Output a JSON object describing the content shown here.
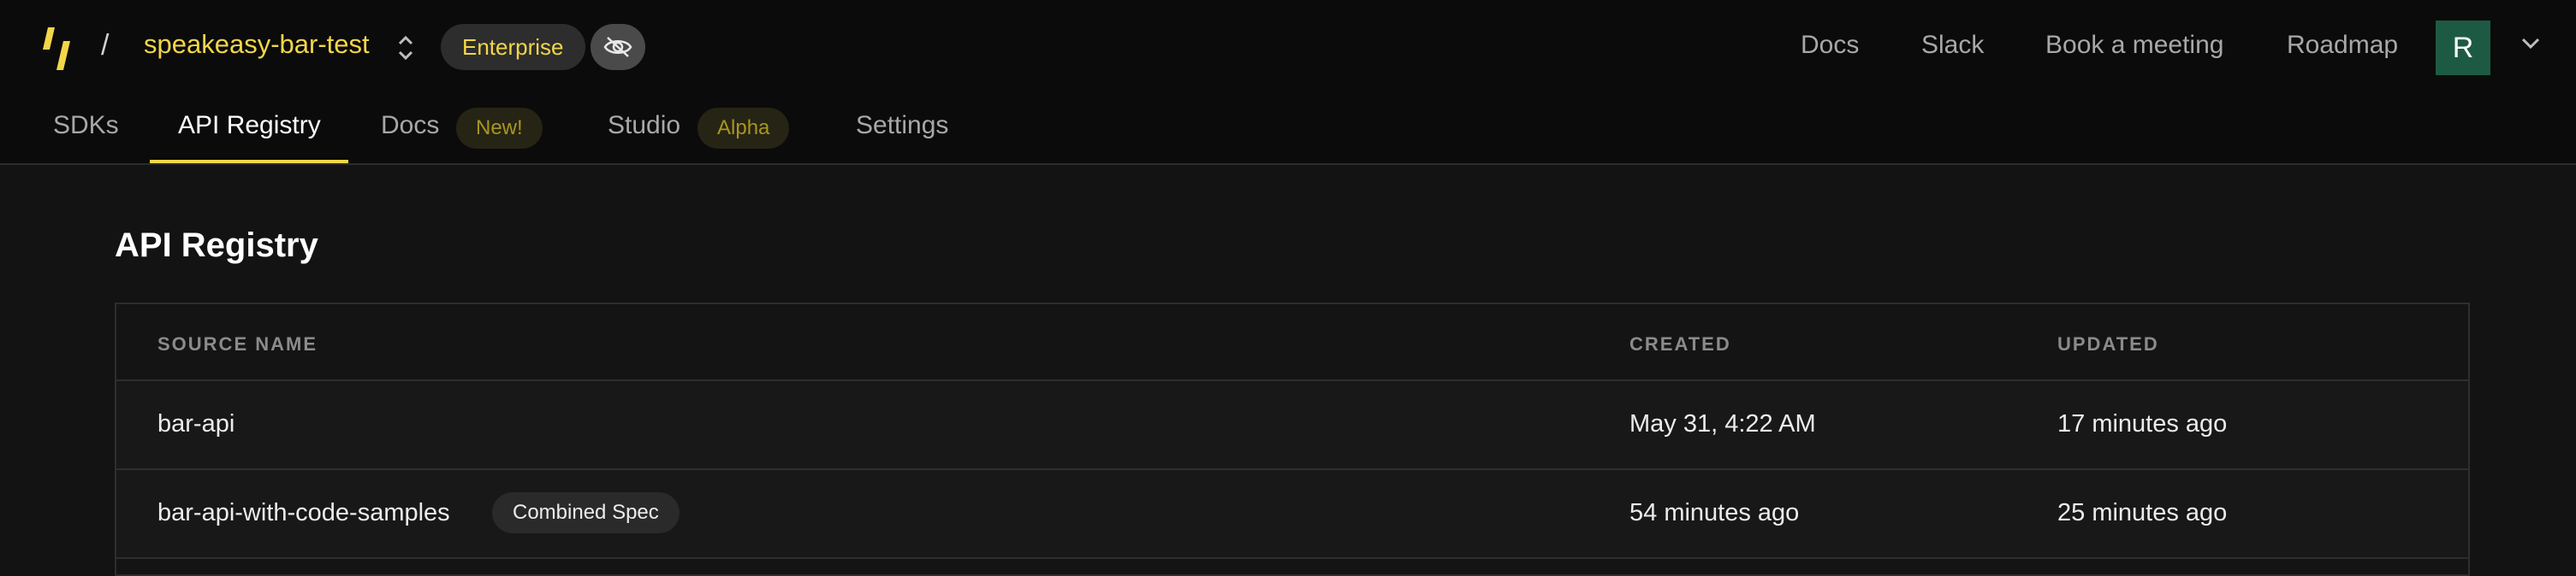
{
  "header": {
    "separator": "/",
    "project_name": "speakeasy-bar-test",
    "plan_badge": "Enterprise",
    "links": [
      "Docs",
      "Slack",
      "Book a meeting",
      "Roadmap"
    ],
    "avatar_initial": "R"
  },
  "tabs": [
    {
      "label": "SDKs"
    },
    {
      "label": "API Registry",
      "active": true
    },
    {
      "label": "Docs",
      "badge": "New!"
    },
    {
      "label": "Studio",
      "badge": "Alpha"
    },
    {
      "label": "Settings"
    }
  ],
  "colors": {
    "accent": "#f2d64a",
    "avatar_bg": "#1d5a44"
  },
  "icons": [
    "speakeasy-logo-icon",
    "chevron-up-down-icon",
    "eye-off-icon",
    "chevron-down-icon"
  ],
  "page": {
    "title": "API Registry"
  },
  "table": {
    "columns": [
      "SOURCE NAME",
      "CREATED",
      "UPDATED"
    ],
    "rows": [
      {
        "name": "bar-api",
        "created": "May 31, 4:22 AM",
        "updated": "17 minutes ago"
      },
      {
        "name": "bar-api-with-code-samples",
        "badge": "Combined Spec",
        "created": "54 minutes ago",
        "updated": "25 minutes ago"
      }
    ]
  }
}
